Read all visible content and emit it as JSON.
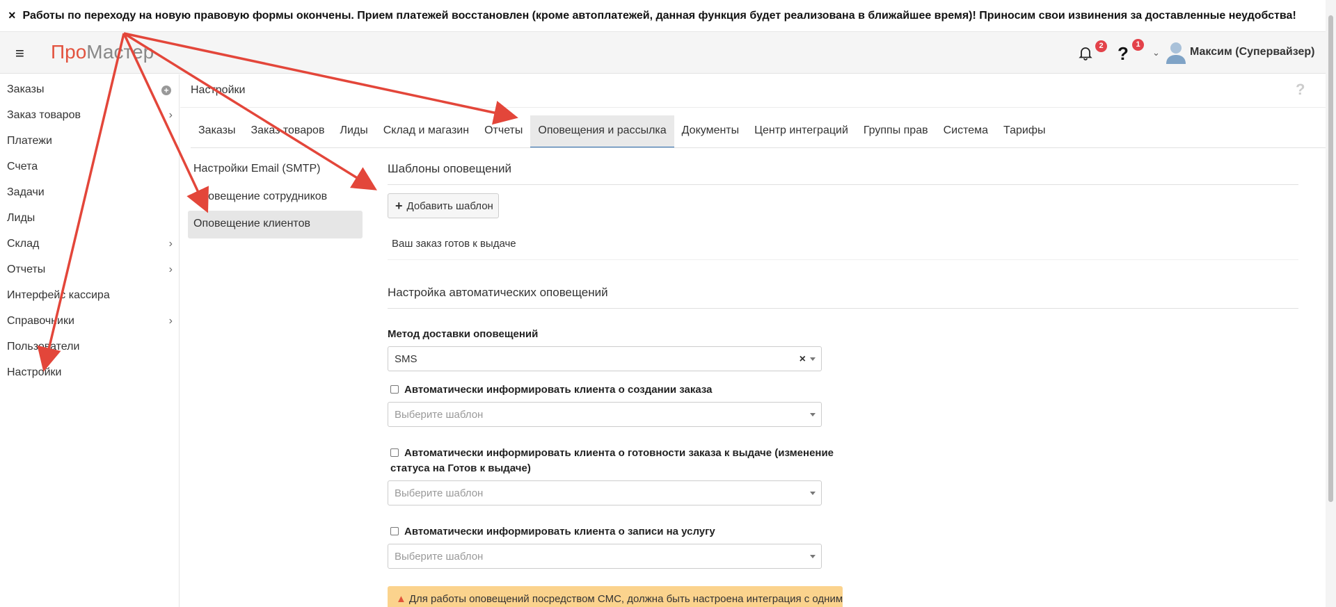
{
  "notice": {
    "close_icon": "×",
    "text": "Работы по переходу на новую правовую формы окончены. Прием платежей восстановлен (кроме автоплатежей, данная функция будет реализована в ближайшее время)! Приносим свои извинения за доставленные неудобства!"
  },
  "header": {
    "menu_icon": "≡",
    "logo_part1": "Про",
    "logo_part2": "Мастер",
    "notifications_count": "2",
    "help_icon": "?",
    "help_count": "1",
    "caret": "⌄",
    "user_name": "Максим (Супервайзер)"
  },
  "sidebar": {
    "items": [
      {
        "label": "Заказы",
        "suffix": "plus"
      },
      {
        "label": "Заказ товаров",
        "suffix": "chevron"
      },
      {
        "label": "Платежи",
        "suffix": ""
      },
      {
        "label": "Счета",
        "suffix": ""
      },
      {
        "label": "Задачи",
        "suffix": ""
      },
      {
        "label": "Лиды",
        "suffix": ""
      },
      {
        "label": "Склад",
        "suffix": "chevron"
      },
      {
        "label": "Отчеты",
        "suffix": "chevron"
      },
      {
        "label": "Интерфейс кассира",
        "suffix": ""
      },
      {
        "label": "Справочники",
        "suffix": "chevron"
      },
      {
        "label": "Пользователи",
        "suffix": ""
      },
      {
        "label": "Настройки",
        "suffix": ""
      }
    ],
    "chevron": "›",
    "plus": "+"
  },
  "page": {
    "title": "Настройки",
    "help_icon": "?"
  },
  "tabs": [
    {
      "label": "Заказы",
      "active": false
    },
    {
      "label": "Заказ товаров",
      "active": false
    },
    {
      "label": "Лиды",
      "active": false
    },
    {
      "label": "Склад и магазин",
      "active": false
    },
    {
      "label": "Отчеты",
      "active": false
    },
    {
      "label": "Оповещения и рассылка",
      "active": true
    },
    {
      "label": "Документы",
      "active": false
    },
    {
      "label": "Центр интеграций",
      "active": false
    },
    {
      "label": "Группы прав",
      "active": false
    },
    {
      "label": "Система",
      "active": false
    },
    {
      "label": "Тарифы",
      "active": false
    }
  ],
  "submenu": [
    {
      "label": "Настройки Email (SMTP)",
      "active": false
    },
    {
      "label": "Оповещение сотрудников",
      "active": false
    },
    {
      "label": "Оповещение клиентов",
      "active": true
    }
  ],
  "templates": {
    "title": "Шаблоны оповещений",
    "add_icon": "+",
    "add_button": "Добавить шаблон",
    "items": [
      "Ваш заказ готов к выдаче"
    ]
  },
  "auto": {
    "title": "Настройка автоматических оповещений",
    "delivery_label": "Метод доставки оповещений",
    "delivery_value": "SMS",
    "clear_icon": "×",
    "checks": [
      {
        "label": "Автоматически информировать клиента о создании заказа",
        "checked": false,
        "placeholder": "Выберите шаблон"
      },
      {
        "label": "Автоматически информировать клиента о готовности заказа к выдаче (изменение статуса на Готов к выдаче)",
        "checked": false,
        "placeholder": "Выберите шаблон"
      },
      {
        "label": "Автоматически информировать клиента о записи на услугу",
        "checked": false,
        "placeholder": "Выберите шаблон"
      }
    ],
    "warning_icon": "▲",
    "warning_text": "Для работы оповещений посредством СМС, должна быть настроена интеграция с одним"
  },
  "colors": {
    "accent": "#2b6cb0",
    "logo_red": "#e2533f",
    "badge": "#e3424a",
    "warning_bg": "#fbd38d",
    "annotation_arrow": "#e3463a"
  }
}
